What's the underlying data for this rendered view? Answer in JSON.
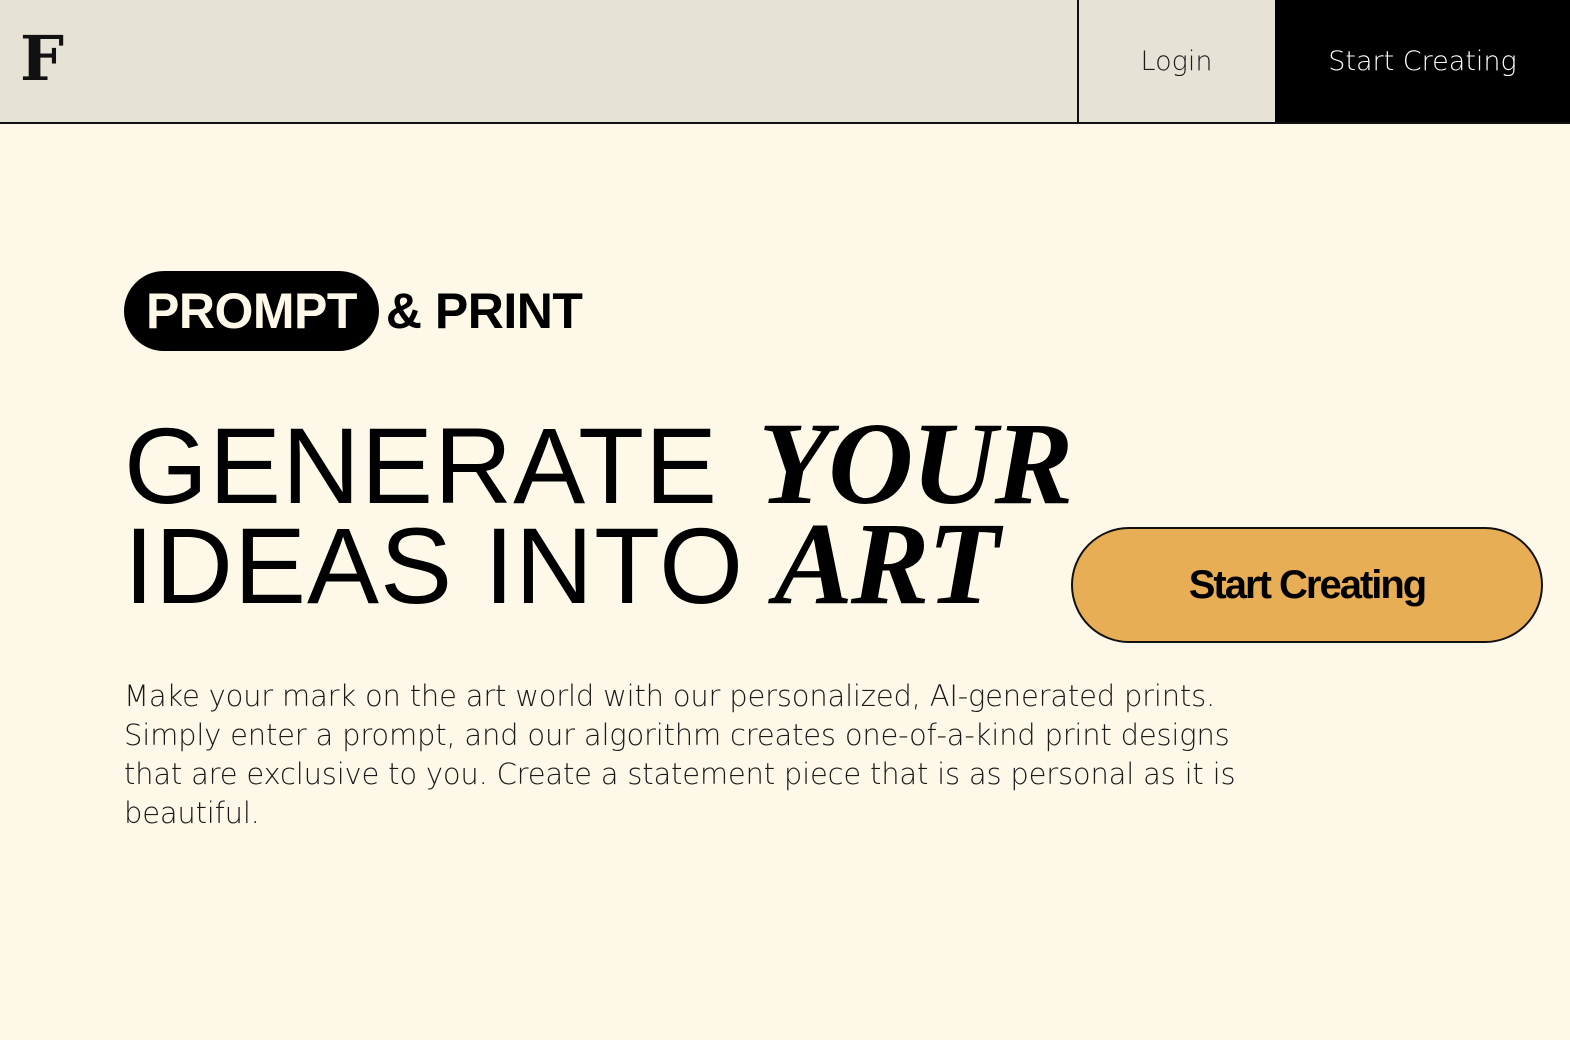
{
  "header": {
    "logo": "F",
    "login_label": "Login",
    "cta_label": "Start Creating"
  },
  "hero": {
    "tag_pill": "PROMPT",
    "tag_rest": "& PRINT",
    "headline_line1_regular": "GENERATE",
    "headline_line1_italic": "YOUR",
    "headline_line2_regular": "IDEAS INTO",
    "headline_line2_italic": "ART",
    "cta_label": "Start Creating",
    "description": "Make your mark on the art world with our personalized, AI-generated prints. Simply enter a prompt, and our algorithm creates one-of-a-kind print designs that are exclusive to you. Create a statement piece that is as personal as it is beautiful."
  },
  "colors": {
    "page_background": "#fdf8e8",
    "header_background": "#e6e2d6",
    "cta_accent": "#e8ae55",
    "dark": "#000000"
  }
}
